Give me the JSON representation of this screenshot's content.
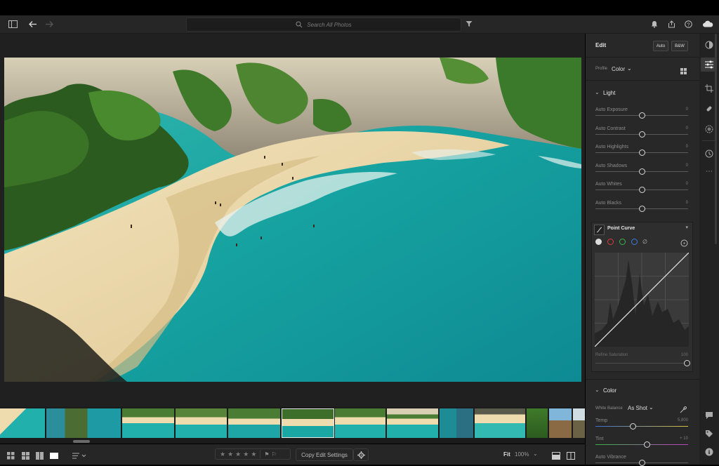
{
  "topbar": {
    "search_placeholder": "Search All Photos",
    "icons": [
      "sidebar-icon",
      "back-arrow-icon",
      "forward-arrow-icon",
      "filter-icon",
      "bell-icon",
      "share-icon",
      "help-icon",
      "cloud-icon"
    ]
  },
  "edit_panel": {
    "title": "Edit",
    "auto_label": "Auto",
    "bw_label": "B&W",
    "profile_label": "Profile",
    "profile_value": "Color",
    "light_section": "Light",
    "light_sliders": [
      {
        "label": "Auto Exposure",
        "value": "0",
        "position": 0.5
      },
      {
        "label": "Auto Contrast",
        "value": "0",
        "position": 0.5
      },
      {
        "label": "Auto Highlights",
        "value": "0",
        "position": 0.5
      },
      {
        "label": "Auto Shadows",
        "value": "0",
        "position": 0.5
      },
      {
        "label": "Auto Whites",
        "value": "0",
        "position": 0.5
      },
      {
        "label": "Auto Blacks",
        "value": "0",
        "position": 0.5
      }
    ],
    "point_curve_title": "Point Curve",
    "refine_saturation_label": "Refine Saturation",
    "refine_saturation_value": "100",
    "color_section": "Color",
    "white_balance_label": "White Balance",
    "white_balance_value": "As Shot",
    "color_sliders": [
      {
        "label": "Temp",
        "value": "5,800",
        "position": 0.4
      },
      {
        "label": "Tint",
        "value": "+ 10",
        "position": 0.55
      },
      {
        "label": "Auto Vibrance",
        "value": "",
        "position": 0.5
      }
    ]
  },
  "bottombar": {
    "copy_edit_settings": "Copy Edit Settings",
    "fit_label": "Fit",
    "zoom_label": "100%",
    "rating_stars": 5
  },
  "colors": {
    "accent": "#e0e0e0",
    "panel_bg": "#282828",
    "sea": "#1aa7a4",
    "sand": "#eedbae"
  }
}
